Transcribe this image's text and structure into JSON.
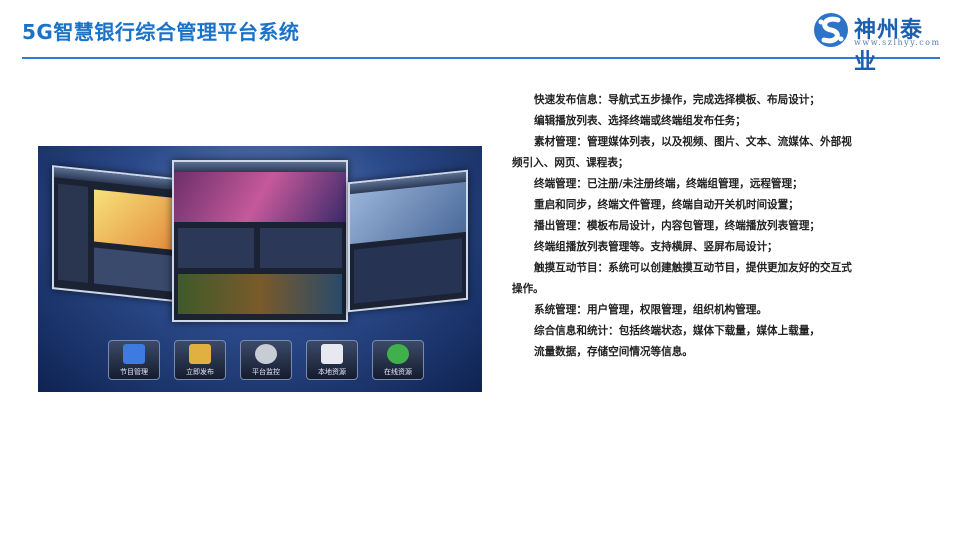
{
  "header": {
    "title": "5G智慧银行综合管理平台系统",
    "logo_name": "神州泰业",
    "logo_url": "www.szlhyy.com"
  },
  "screenshot": {
    "dock": [
      "节目管理",
      "立即发布",
      "平台监控",
      "本地资源",
      "在线资源"
    ]
  },
  "paragraphs": [
    "快速发布信息：导航式五步操作，完成选择模板、布局设计；",
    "编辑播放列表、选择终端或终端组发布任务；",
    "素材管理：管理媒体列表，以及视频、图片、文本、流媒体、外部视频引入、网页、课程表；",
    "终端管理：已注册/未注册终端，终端组管理，远程管理；",
    "重启和同步，终端文件管理，终端自动开关机时间设置；",
    "播出管理：模板布局设计，内容包管理，终端播放列表管理；",
    "终端组播放列表管理等。支持横屏、竖屏布局设计；",
    "触摸互动节目：系统可以创建触摸互动节目，提供更加友好的交互式操作。",
    "系统管理：用户管理，权限管理，组织机构管理。",
    "综合信息和统计：包括终端状态，媒体下载量，媒体上载量，",
    "流量数据，存储空间情况等信息。"
  ],
  "colors": {
    "title": "#1a73c9",
    "rule": "#2a7fd0"
  }
}
